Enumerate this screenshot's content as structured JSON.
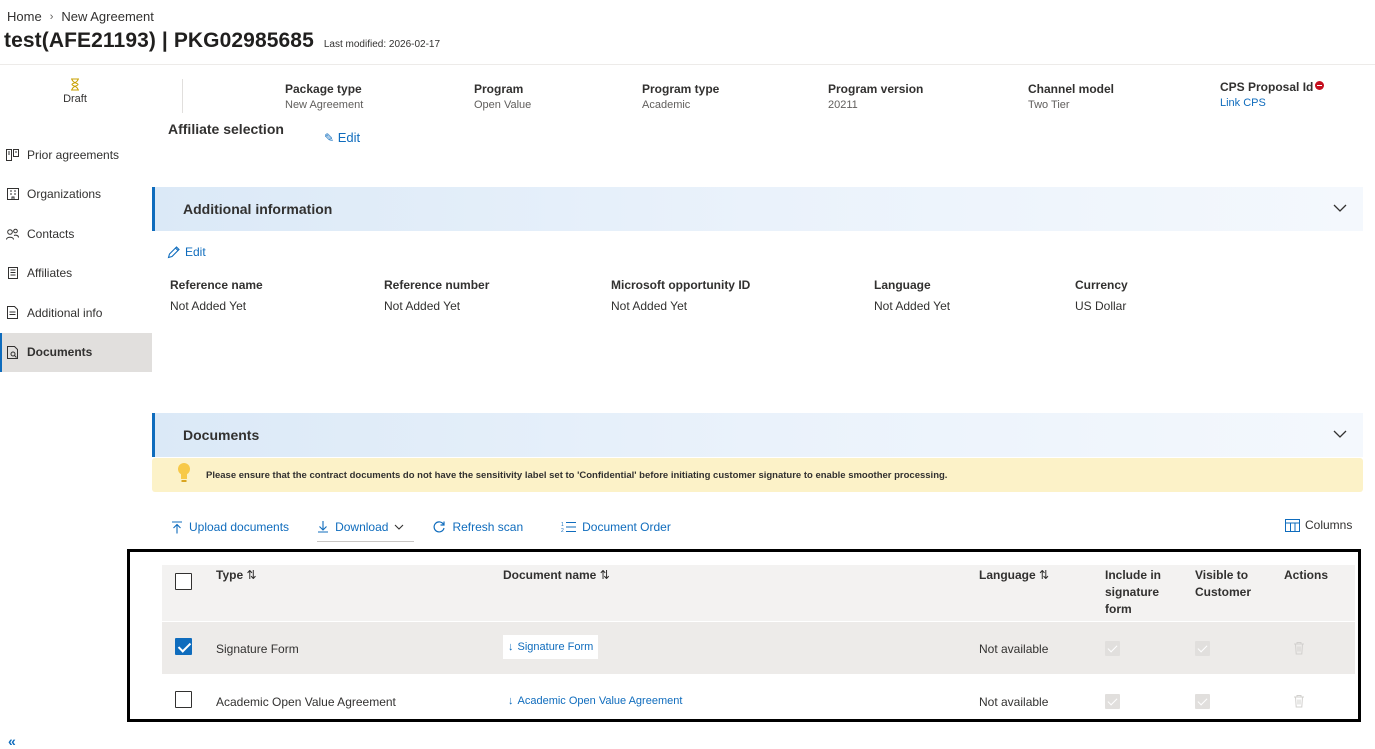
{
  "breadcrumb": {
    "home": "Home",
    "separator": "›",
    "current": "New Agreement"
  },
  "title": {
    "main": "test(AFE21193) | PKG02985685",
    "modified": "Last modified: 2026-02-17"
  },
  "status": {
    "label": "Draft",
    "icon": "hourglass-icon"
  },
  "summary": [
    {
      "key": "Package type",
      "value": "New Agreement"
    },
    {
      "key": "Program",
      "value": "Open Value"
    },
    {
      "key": "Program type",
      "value": "Academic"
    },
    {
      "key": "Program version",
      "value": "20211"
    },
    {
      "key": "Channel model",
      "value": "Two Tier"
    },
    {
      "key": "CPS Proposal Id",
      "value": "Link CPS"
    }
  ],
  "sidebar": {
    "items": [
      {
        "label": "Prior agreements",
        "icon": "agreements-icon"
      },
      {
        "label": "Organizations",
        "icon": "building-icon"
      },
      {
        "label": "Contacts",
        "icon": "people-icon"
      },
      {
        "label": "Affiliates",
        "icon": "affiliates-icon"
      },
      {
        "label": "Additional info",
        "icon": "document-icon"
      },
      {
        "label": "Documents",
        "icon": "documents-icon",
        "active": true
      }
    ],
    "collapse": "«"
  },
  "affiliate_section": {
    "title": "Affiliate selection",
    "edit": "Edit"
  },
  "additional_info": {
    "title": "Additional information",
    "edit": "Edit",
    "fields": [
      {
        "key": "Reference name",
        "value": "Not Added Yet"
      },
      {
        "key": "Reference number",
        "value": "Not Added Yet"
      },
      {
        "key": "Microsoft opportunity ID",
        "value": "Not Added Yet"
      },
      {
        "key": "Language",
        "value": "Not Added Yet"
      },
      {
        "key": "Currency",
        "value": "US Dollar"
      }
    ]
  },
  "documents": {
    "title": "Documents",
    "notice": "Please ensure that the contract documents do not have the sensitivity label set to 'Confidential' before initiating customer signature to enable smoother processing.",
    "toolbar": {
      "upload": "Upload documents",
      "download": "Download",
      "refresh": "Refresh scan",
      "order": "Document Order",
      "columns": "Columns"
    },
    "columns": {
      "type": "Type",
      "name": "Document name",
      "language": "Language",
      "include_1": "Include in",
      "include_2": "signature",
      "include_3": "form",
      "visible_1": "Visible to",
      "visible_2": "Customer",
      "actions": "Actions"
    },
    "rows": [
      {
        "type": "Signature Form",
        "name": "Signature Form",
        "language": "Not available",
        "selected": true
      },
      {
        "type": "Academic Open Value Agreement",
        "name": "Academic Open Value Agreement",
        "language": "Not available",
        "selected": false
      }
    ]
  },
  "colors": {
    "accent": "#0f6cbd",
    "notice_bg": "#fcf2c8",
    "status_red": "#c50f1f"
  }
}
